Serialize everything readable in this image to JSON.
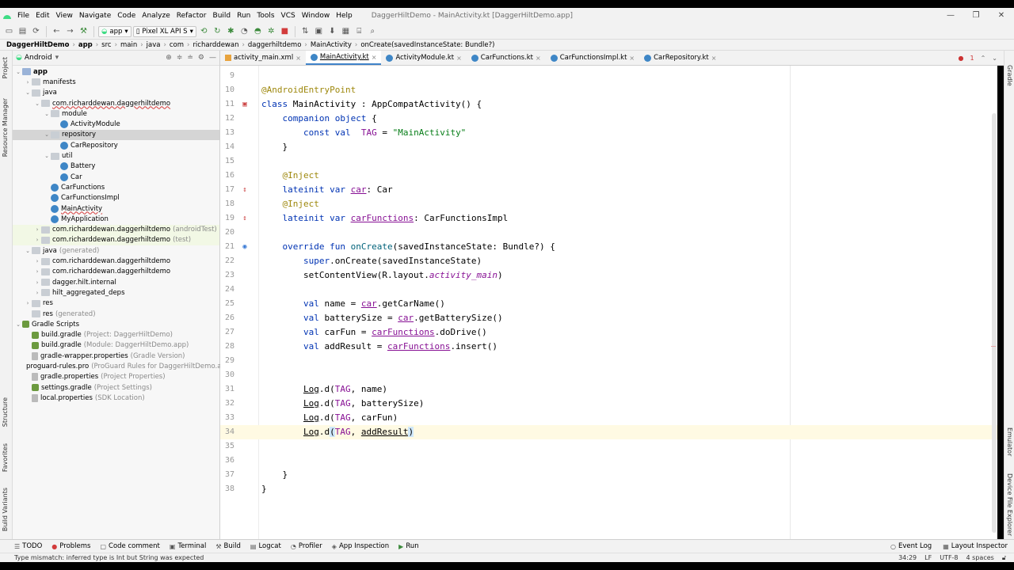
{
  "window": {
    "title": "DaggerHiltDemo - MainActivity.kt [DaggerHiltDemo.app]",
    "controls": [
      "—",
      "❐",
      "✕"
    ]
  },
  "menu": [
    "File",
    "Edit",
    "View",
    "Navigate",
    "Code",
    "Analyze",
    "Refactor",
    "Build",
    "Run",
    "Tools",
    "VCS",
    "Window",
    "Help"
  ],
  "toolbar": {
    "module_combo": "app",
    "device_combo": "Pixel XL API S"
  },
  "breadcrumbs": [
    "DaggerHiltDemo",
    "app",
    "src",
    "main",
    "java",
    "com",
    "richarddewan",
    "daggerhiltdemo",
    "MainActivity",
    "onCreate(savedInstanceState: Bundle?)"
  ],
  "left_stripe": [
    "Project",
    "Resource Manager",
    "Structure",
    "Favorites",
    "Build Variants"
  ],
  "right_stripe": [
    "Gradle",
    "Emulator",
    "Device File Explorer"
  ],
  "project_panel": {
    "view_mode": "Android",
    "tree": [
      {
        "label": "app",
        "hint": "",
        "icon": "folder-blue",
        "chev": "⌄",
        "bold": true
      },
      {
        "label": "manifests",
        "hint": "",
        "icon": "folder",
        "chev": "›"
      },
      {
        "label": "java",
        "hint": "",
        "icon": "folder",
        "chev": "⌄"
      },
      {
        "label": "com.richarddewan.daggerhiltdemo",
        "hint": "",
        "icon": "folder",
        "chev": "⌄",
        "underline": true
      },
      {
        "label": "module",
        "hint": "",
        "icon": "folder",
        "chev": "⌄"
      },
      {
        "label": "ActivityModule",
        "hint": "",
        "icon": "kt",
        "chev": ""
      },
      {
        "label": "repository",
        "hint": "",
        "icon": "folder",
        "chev": "⌄",
        "selected": true
      },
      {
        "label": "CarRepository",
        "hint": "",
        "icon": "kt",
        "chev": ""
      },
      {
        "label": "util",
        "hint": "",
        "icon": "folder",
        "chev": "⌄"
      },
      {
        "label": "Battery",
        "hint": "",
        "icon": "kt",
        "chev": ""
      },
      {
        "label": "Car",
        "hint": "",
        "icon": "kt",
        "chev": ""
      },
      {
        "label": "CarFunctions",
        "hint": "",
        "icon": "kt",
        "chev": ""
      },
      {
        "label": "CarFunctionsImpl",
        "hint": "",
        "icon": "kt",
        "chev": ""
      },
      {
        "label": "MainActivity",
        "hint": "",
        "icon": "kt",
        "chev": "",
        "underline": true
      },
      {
        "label": "MyApplication",
        "hint": "",
        "icon": "kt",
        "chev": ""
      },
      {
        "label": "com.richarddewan.daggerhiltdemo",
        "hint": "(androidTest)",
        "icon": "folder",
        "chev": "›",
        "highlight": true
      },
      {
        "label": "com.richarddewan.daggerhiltdemo",
        "hint": "(test)",
        "icon": "folder",
        "chev": "›",
        "highlight": true
      },
      {
        "label": "java",
        "hint": "(generated)",
        "icon": "folder",
        "chev": "⌄"
      },
      {
        "label": "com.richarddewan.daggerhiltdemo",
        "hint": "",
        "icon": "folder",
        "chev": "›"
      },
      {
        "label": "com.richarddewan.daggerhiltdemo",
        "hint": "",
        "icon": "folder",
        "chev": "›"
      },
      {
        "label": "dagger.hilt.internal",
        "hint": "",
        "icon": "folder",
        "chev": "›"
      },
      {
        "label": "hilt_aggregated_deps",
        "hint": "",
        "icon": "folder",
        "chev": "›"
      },
      {
        "label": "res",
        "hint": "",
        "icon": "folder",
        "chev": "›"
      },
      {
        "label": "res",
        "hint": "(generated)",
        "icon": "folder",
        "chev": ""
      },
      {
        "label": "Gradle Scripts",
        "hint": "",
        "icon": "gradle",
        "chev": "⌄"
      },
      {
        "label": "build.gradle",
        "hint": "(Project: DaggerHiltDemo)",
        "icon": "gradle",
        "chev": ""
      },
      {
        "label": "build.gradle",
        "hint": "(Module: DaggerHiltDemo.app)",
        "icon": "gradle",
        "chev": ""
      },
      {
        "label": "gradle-wrapper.properties",
        "hint": "(Gradle Version)",
        "icon": "file",
        "chev": ""
      },
      {
        "label": "proguard-rules.pro",
        "hint": "(ProGuard Rules for DaggerHiltDemo.app)",
        "icon": "file",
        "chev": ""
      },
      {
        "label": "gradle.properties",
        "hint": "(Project Properties)",
        "icon": "file",
        "chev": ""
      },
      {
        "label": "settings.gradle",
        "hint": "(Project Settings)",
        "icon": "gradle",
        "chev": ""
      },
      {
        "label": "local.properties",
        "hint": "(SDK Location)",
        "icon": "file",
        "chev": ""
      }
    ]
  },
  "tabs": [
    {
      "label": "activity_main.xml",
      "type": "xml",
      "active": false
    },
    {
      "label": "MainActivity.kt",
      "type": "kt",
      "active": true
    },
    {
      "label": "ActivityModule.kt",
      "type": "kt",
      "active": false
    },
    {
      "label": "CarFunctions.kt",
      "type": "kt",
      "active": false
    },
    {
      "label": "CarFunctionsImpl.kt",
      "type": "kt",
      "active": false
    },
    {
      "label": "CarRepository.kt",
      "type": "kt",
      "active": false
    }
  ],
  "error_count": "1",
  "code_lines": [
    {
      "n": "9",
      "html": ""
    },
    {
      "n": "10",
      "html": "<span class='ann'>@AndroidEntryPoint</span>"
    },
    {
      "n": "11",
      "html": "<span class='kw'>class</span> MainActivity : AppCompatActivity() {",
      "gicon": "▣",
      "gcolor": "#c44"
    },
    {
      "n": "12",
      "html": "    <span class='kw'>companion object</span> {"
    },
    {
      "n": "13",
      "html": "        <span class='kw'>const val</span>  <span class='prop'>TAG</span> = <span class='str'>\"MainActivity\"</span>"
    },
    {
      "n": "14",
      "html": "    }"
    },
    {
      "n": "15",
      "html": ""
    },
    {
      "n": "16",
      "html": "    <span class='ann'>@Inject</span>"
    },
    {
      "n": "17",
      "html": "    <span class='kw'>lateinit var</span> <span class='prop und'>car</span>: Car",
      "gicon": "↕",
      "gcolor": "#c44"
    },
    {
      "n": "18",
      "html": "    <span class='ann'>@Inject</span>"
    },
    {
      "n": "19",
      "html": "    <span class='kw'>lateinit var</span> <span class='prop und'>carFunctions</span>: CarFunctionsImpl",
      "gicon": "↕",
      "gcolor": "#c44"
    },
    {
      "n": "20",
      "html": ""
    },
    {
      "n": "21",
      "html": "    <span class='kw'>override fun</span> <span class='fn'>onCreate</span>(savedInstanceState: Bundle?) {",
      "gicon": "◉",
      "gcolor": "#3b7bd6"
    },
    {
      "n": "22",
      "html": "        <span class='kw'>super</span>.onCreate(savedInstanceState)"
    },
    {
      "n": "23",
      "html": "        setContentView(R.layout.<span class='ital'>activity_main</span>)"
    },
    {
      "n": "24",
      "html": ""
    },
    {
      "n": "25",
      "html": "        <span class='kw'>val</span> name = <span class='prop und'>car</span>.getCarName()"
    },
    {
      "n": "26",
      "html": "        <span class='kw'>val</span> batterySize = <span class='prop und'>car</span>.getBatterySize()"
    },
    {
      "n": "27",
      "html": "        <span class='kw'>val</span> carFun = <span class='prop und'>carFunctions</span>.doDrive()"
    },
    {
      "n": "28",
      "html": "        <span class='kw'>val</span> addResult = <span class='prop und'>carFunctions</span>.insert()"
    },
    {
      "n": "29",
      "html": ""
    },
    {
      "n": "30",
      "html": ""
    },
    {
      "n": "31",
      "html": "        <span class='und'>Log</span>.d(<span class='prop'>TAG</span>, name)"
    },
    {
      "n": "32",
      "html": "        <span class='und'>Log</span>.d(<span class='prop'>TAG</span>, batterySize)"
    },
    {
      "n": "33",
      "html": "        <span class='und'>Log</span>.d(<span class='prop'>TAG</span>, carFun)"
    },
    {
      "n": "34",
      "html": "        <span class='und'>Log</span>.d<span class='brace-hl'>(</span><span class='prop'>TAG</span>, <span class='und'>addResult</span><span class='brace-hl'>)</span>",
      "current": true
    },
    {
      "n": "35",
      "html": ""
    },
    {
      "n": "36",
      "html": ""
    },
    {
      "n": "37",
      "html": "    }"
    },
    {
      "n": "38",
      "html": "}"
    }
  ],
  "bottom_tools": [
    {
      "label": "TODO",
      "icon": "☰"
    },
    {
      "label": "Problems",
      "icon": "●"
    },
    {
      "label": "Code comment",
      "icon": "▢"
    },
    {
      "label": "Terminal",
      "icon": "▣"
    },
    {
      "label": "Build",
      "icon": "⚒"
    },
    {
      "label": "Logcat",
      "icon": "▤"
    },
    {
      "label": "Profiler",
      "icon": "◔"
    },
    {
      "label": "App Inspection",
      "icon": "◈"
    },
    {
      "label": "Run",
      "icon": "▶"
    }
  ],
  "bottom_right_tools": [
    {
      "label": "Event Log",
      "icon": "○"
    },
    {
      "label": "Layout Inspector",
      "icon": "▦"
    }
  ],
  "status": {
    "message": "Type mismatch: inferred type is Int but String was expected",
    "position": "34:29",
    "line_sep": "LF",
    "encoding": "UTF-8",
    "indent": "4 spaces"
  }
}
